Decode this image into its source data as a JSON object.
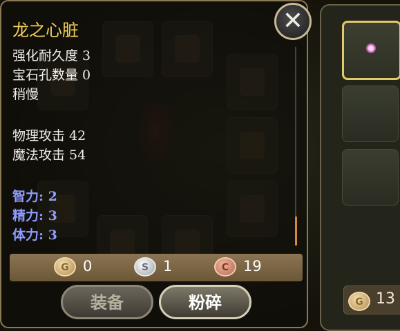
{
  "item": {
    "name": "龙之心脏",
    "enhance_durability": "强化耐久度 3",
    "gem_slots": "宝石孔数量 0",
    "speed": "稍慢",
    "physical_attack": "物理攻击 42",
    "magic_attack": "魔法攻击 54",
    "bonus_stats": [
      "智力: 2",
      "精力: 3",
      "体力: 3"
    ]
  },
  "cost": {
    "gold": {
      "icon": "G",
      "value": "0"
    },
    "silver": {
      "icon": "S",
      "value": "1"
    },
    "copper": {
      "icon": "C",
      "value": "19"
    }
  },
  "buttons": {
    "equip": "装备",
    "smash": "粉碎"
  },
  "close_glyph": "✕",
  "bag": {
    "gold_icon": "G",
    "gold": "13"
  },
  "colors": {
    "title": "#f2cf5a",
    "bonus": "#8f9cff",
    "accent": "#e3c96b"
  }
}
